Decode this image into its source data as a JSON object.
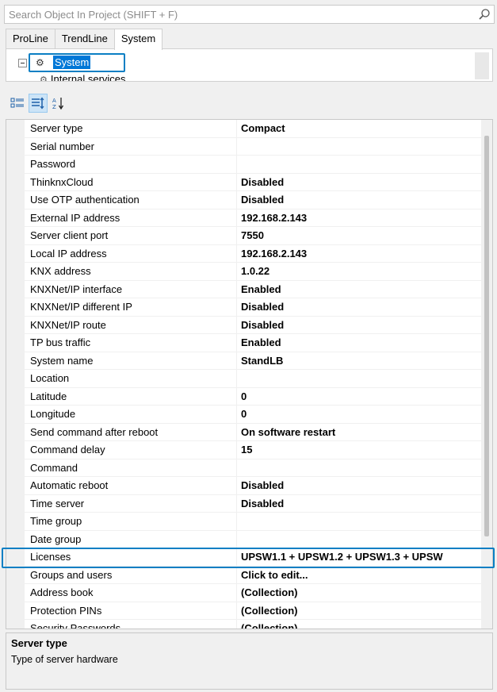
{
  "search": {
    "placeholder": "Search Object In Project (SHIFT + F)",
    "icon": "search-icon"
  },
  "tabs": [
    {
      "label": "ProLine",
      "active": false
    },
    {
      "label": "TrendLine",
      "active": false
    },
    {
      "label": "System",
      "active": true
    }
  ],
  "tree": {
    "selected_label": "System",
    "child_label": "Internal services"
  },
  "properties": [
    {
      "name": "Server type",
      "value": "Compact"
    },
    {
      "name": "Serial number",
      "value": ""
    },
    {
      "name": "Password",
      "value": ""
    },
    {
      "name": "ThinknxCloud",
      "value": "Disabled"
    },
    {
      "name": "Use OTP authentication",
      "value": "Disabled"
    },
    {
      "name": "External IP address",
      "value": "192.168.2.143"
    },
    {
      "name": "Server client port",
      "value": "7550"
    },
    {
      "name": "Local IP address",
      "value": "192.168.2.143"
    },
    {
      "name": "KNX address",
      "value": "1.0.22"
    },
    {
      "name": "KNXNet/IP interface",
      "value": "Enabled"
    },
    {
      "name": "KNXNet/IP different IP",
      "value": "Disabled"
    },
    {
      "name": "KNXNet/IP route",
      "value": "Disabled"
    },
    {
      "name": "TP bus traffic",
      "value": "Enabled"
    },
    {
      "name": "System name",
      "value": "StandLB"
    },
    {
      "name": "Location",
      "value": ""
    },
    {
      "name": "Latitude",
      "value": "0"
    },
    {
      "name": "Longitude",
      "value": "0"
    },
    {
      "name": "Send command after reboot",
      "value": "On software restart"
    },
    {
      "name": "Command delay",
      "value": "15"
    },
    {
      "name": "Command",
      "value": ""
    },
    {
      "name": "Automatic reboot",
      "value": "Disabled"
    },
    {
      "name": "Time server",
      "value": "Disabled"
    },
    {
      "name": "Time group",
      "value": ""
    },
    {
      "name": "Date group",
      "value": ""
    },
    {
      "name": "Licenses",
      "value": "UPSW1.1 + UPSW1.2 + UPSW1.3 + UPSW"
    },
    {
      "name": "Groups and users",
      "value": "Click to edit..."
    },
    {
      "name": "Address book",
      "value": "(Collection)"
    },
    {
      "name": "Protection PINs",
      "value": "(Collection)"
    },
    {
      "name": "Security Passwords",
      "value": "(Collection)"
    }
  ],
  "description": {
    "title": "Server type",
    "text": "Type of server hardware"
  },
  "colors": {
    "accent": "#0a7fc4",
    "selection": "#0078d7"
  }
}
